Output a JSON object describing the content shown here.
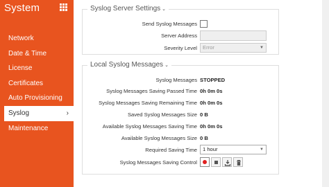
{
  "app": {
    "title": "System"
  },
  "sidebar": {
    "items": [
      {
        "label": "Network"
      },
      {
        "label": "Date & Time"
      },
      {
        "label": "License"
      },
      {
        "label": "Certificates"
      },
      {
        "label": "Auto Provisioning"
      },
      {
        "label": "Syslog",
        "active": true
      },
      {
        "label": "Maintenance"
      }
    ],
    "active_chevron": "›"
  },
  "server_settings": {
    "title": "Syslog Server Settings",
    "caret": "⌄",
    "send_label": "Send Syslog Messages",
    "send_checked": false,
    "address_label": "Server Address",
    "address_value": "",
    "severity_label": "Severity Level",
    "severity_value": "Error"
  },
  "local_messages": {
    "title": "Local Syslog Messages",
    "caret": "⌄",
    "rows": [
      {
        "label": "Syslog Messages",
        "value": "STOPPED"
      },
      {
        "label": "Syslog Messages Saving Passed Time",
        "value": "0h 0m 0s"
      },
      {
        "label": "Syslog Messages Saving Remaining Time",
        "value": "0h 0m 0s"
      },
      {
        "label": "Saved Syslog Messages Size",
        "value": "0 B"
      },
      {
        "label": "Available Syslog Messages Saving Time",
        "value": "0h 0m 0s"
      },
      {
        "label": "Available Syslog Messages Size",
        "value": "0 B"
      }
    ],
    "required_label": "Required Saving Time",
    "required_value": "1 hour",
    "control_label": "Syslog Messages Saving Control",
    "controls": [
      "record-icon",
      "stop-icon",
      "download-icon",
      "trash-icon"
    ]
  },
  "colors": {
    "brand": "#e8541f",
    "record": "#e02020"
  }
}
